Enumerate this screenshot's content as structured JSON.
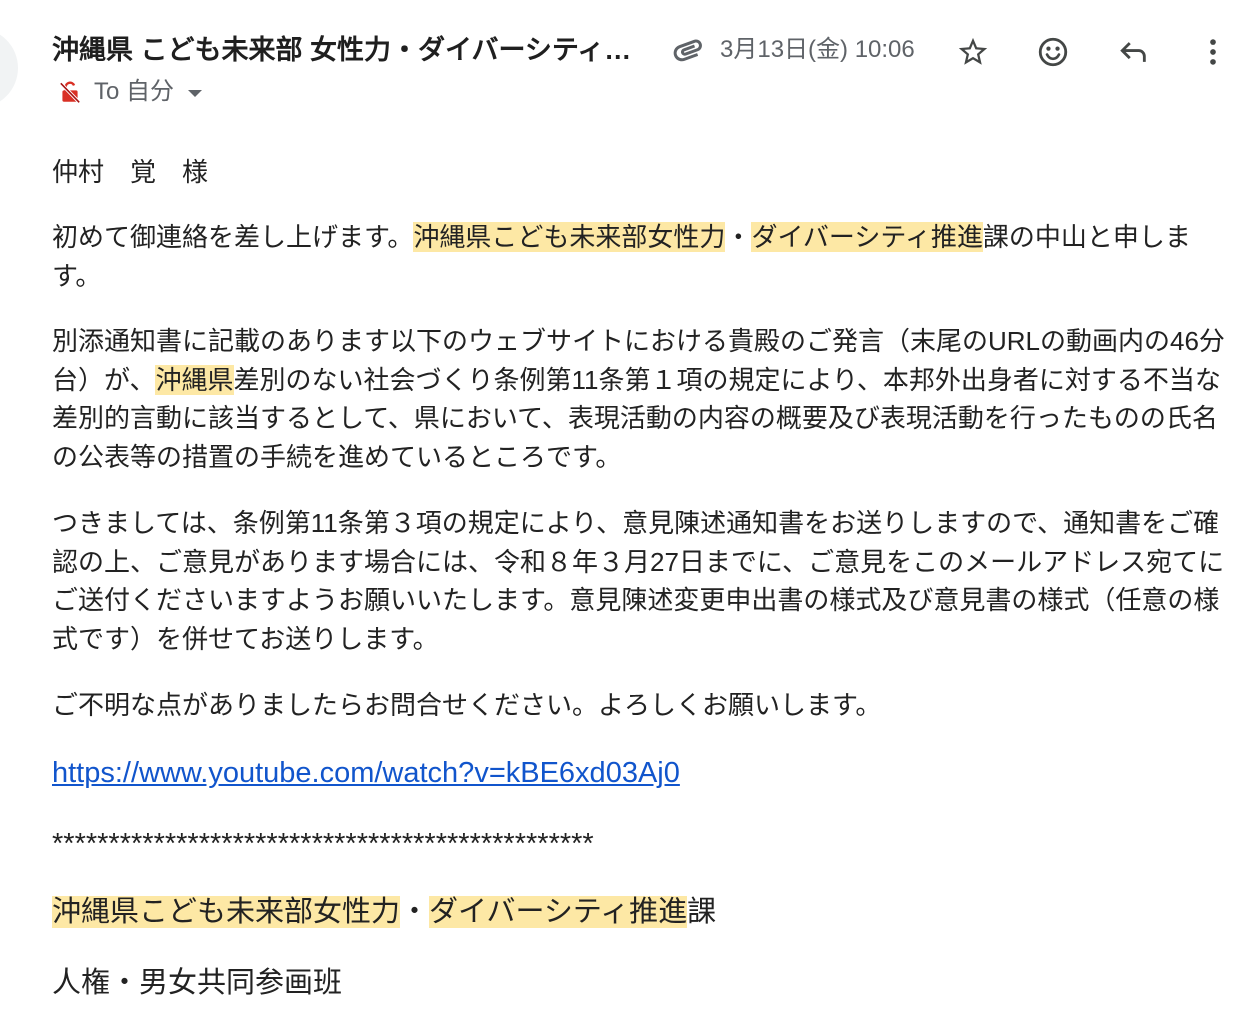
{
  "header": {
    "sender": "沖縄県 こども未来部 女性力・ダイバーシティ…",
    "date": "3月13日(金) 10:06",
    "recipient": "To 自分",
    "icons": {
      "avatar": "sender-avatar",
      "attachment": "paperclip-icon",
      "star": "star-outline-icon",
      "reaction": "emoji-smile-icon",
      "reply": "reply-icon",
      "more": "more-vert-icon",
      "security": "not-encrypted-icon",
      "details": "dropdown-caret-icon"
    }
  },
  "colors": {
    "text": "#222222",
    "heading": "#1f1f1f",
    "secondary": "#5f6368",
    "icon": "#444746",
    "highlight": "#fde8a5",
    "link": "#1155cc",
    "alert": "#d93025",
    "avatar": "#f1f3f4"
  },
  "body": {
    "salutation": "仲村　覚　様",
    "paragraphs": [
      {
        "lines": [
          [
            {
              "text": "初めて御連絡を差し上げます。"
            },
            {
              "text": "沖縄県こども未来部女性力",
              "highlight": true
            },
            {
              "text": "・"
            },
            {
              "text": "ダイバーシティ推進",
              "highlight": true
            },
            {
              "text": "課の中山と申しま"
            }
          ],
          [
            {
              "text": "す。"
            }
          ]
        ]
      },
      {
        "lines": [
          [
            {
              "text": "別添通知書に記載のあります以下のウェブサイトにおける貴殿のご発言（末尾のURLの動画内の46分"
            }
          ],
          [
            {
              "text": "台）が、"
            },
            {
              "text": "沖縄県",
              "highlight": true
            },
            {
              "text": "差別のない社会づくり条例第11条第１項の規定により、本邦外出身者に対する不当な"
            }
          ],
          [
            {
              "text": "差別的言動に該当するとして、県において、表現活動の内容の概要及び表現活動を行ったものの氏名"
            }
          ],
          [
            {
              "text": "の公表等の措置の手続を進めているところです。"
            }
          ]
        ]
      },
      {
        "lines": [
          [
            {
              "text": "つきましては、条例第11条第３項の規定により、意見陳述通知書をお送りしますので、通知書をご確"
            }
          ],
          [
            {
              "text": "認の上、ご意見があります場合には、令和８年３月27日までに、ご意見をこのメールアドレス宛てに"
            }
          ],
          [
            {
              "text": "ご送付くださいますようお願いいたします。意見陳述変更申出書の様式及び意見書の様式（任意の様"
            }
          ],
          [
            {
              "text": "式です）を併せてお送りします。"
            }
          ]
        ]
      },
      {
        "lines": [
          [
            {
              "text": "ご不明な点がありましたらお問合せください。よろしくお願いします。"
            }
          ]
        ]
      }
    ],
    "link": "https://www.youtube.com/watch?v=kBE6xd03Aj0",
    "separator": "************************************************",
    "signature": {
      "department": [
        {
          "text": "沖縄県こども未来部女性力",
          "highlight": true
        },
        {
          "text": "・"
        },
        {
          "text": "ダイバーシティ推進",
          "highlight": true
        },
        {
          "text": "課"
        }
      ],
      "section": "人権・男女共同参画班"
    }
  }
}
